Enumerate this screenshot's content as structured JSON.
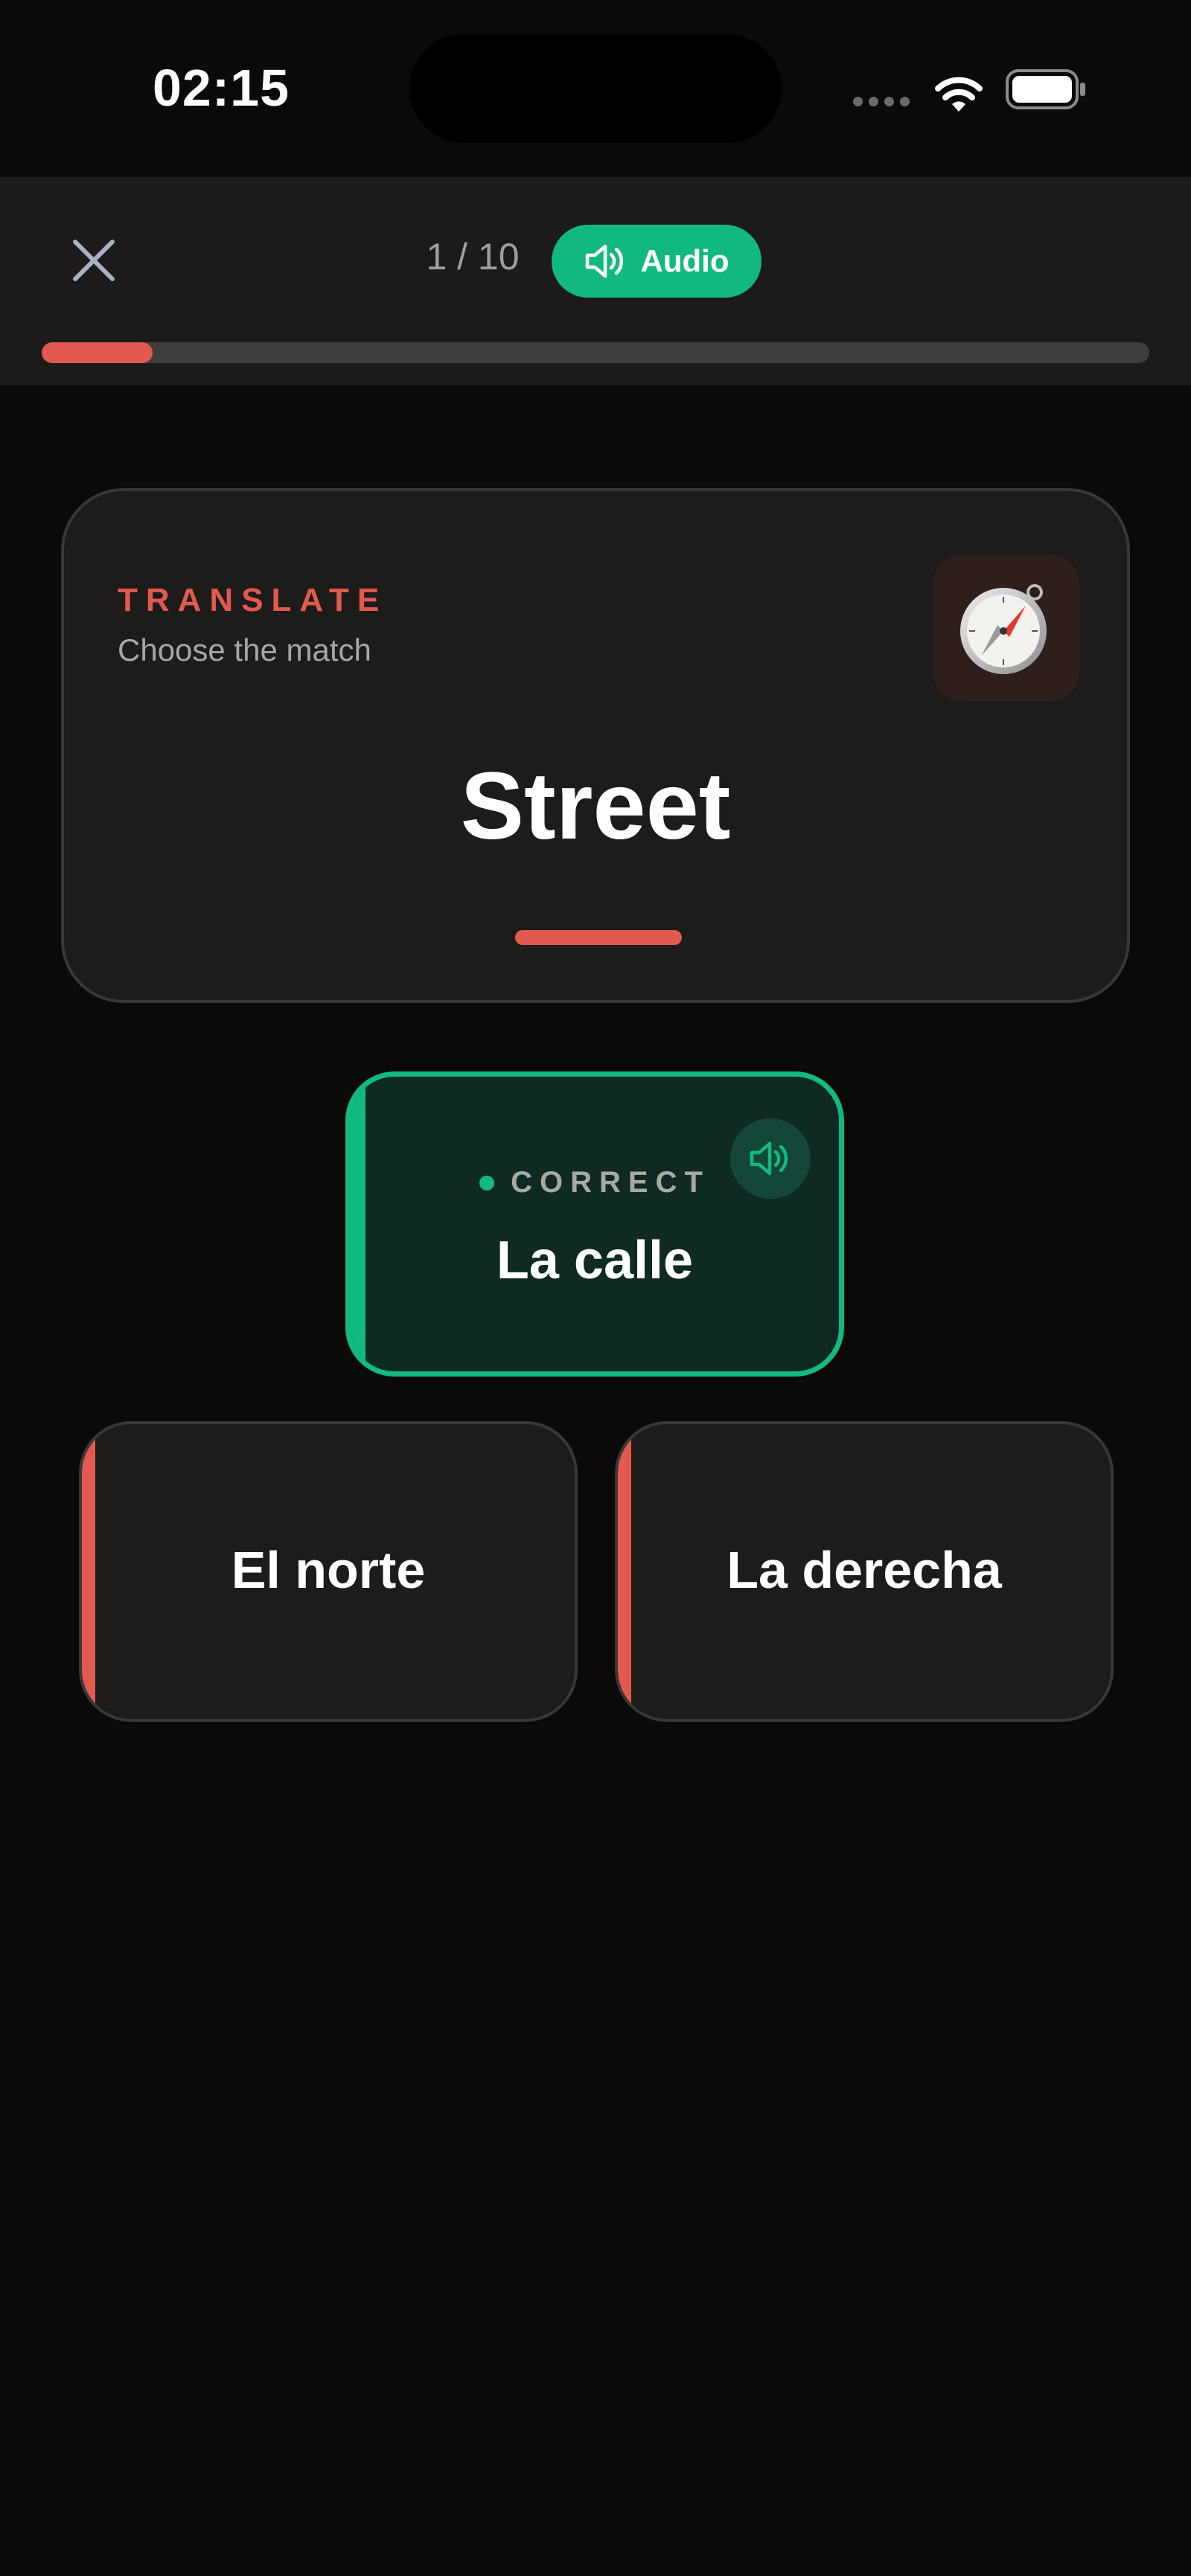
{
  "status_bar": {
    "time": "02:15"
  },
  "header": {
    "counter": "1 / 10",
    "audio_label": "Audio",
    "progress": 0.1
  },
  "prompt": {
    "kicker": "TRANSLATE",
    "instruction": "Choose the match",
    "word": "Street",
    "category_icon": "compass-icon"
  },
  "options": {
    "correct": {
      "status": "CORRECT",
      "text": "La calle"
    },
    "wrong": [
      {
        "text": "El norte"
      },
      {
        "text": "La derecha"
      }
    ]
  },
  "colors": {
    "accent_green": "#12b981",
    "accent_red": "#e25a4f",
    "background": "#0b0a09",
    "card": "#1d1c1b"
  }
}
